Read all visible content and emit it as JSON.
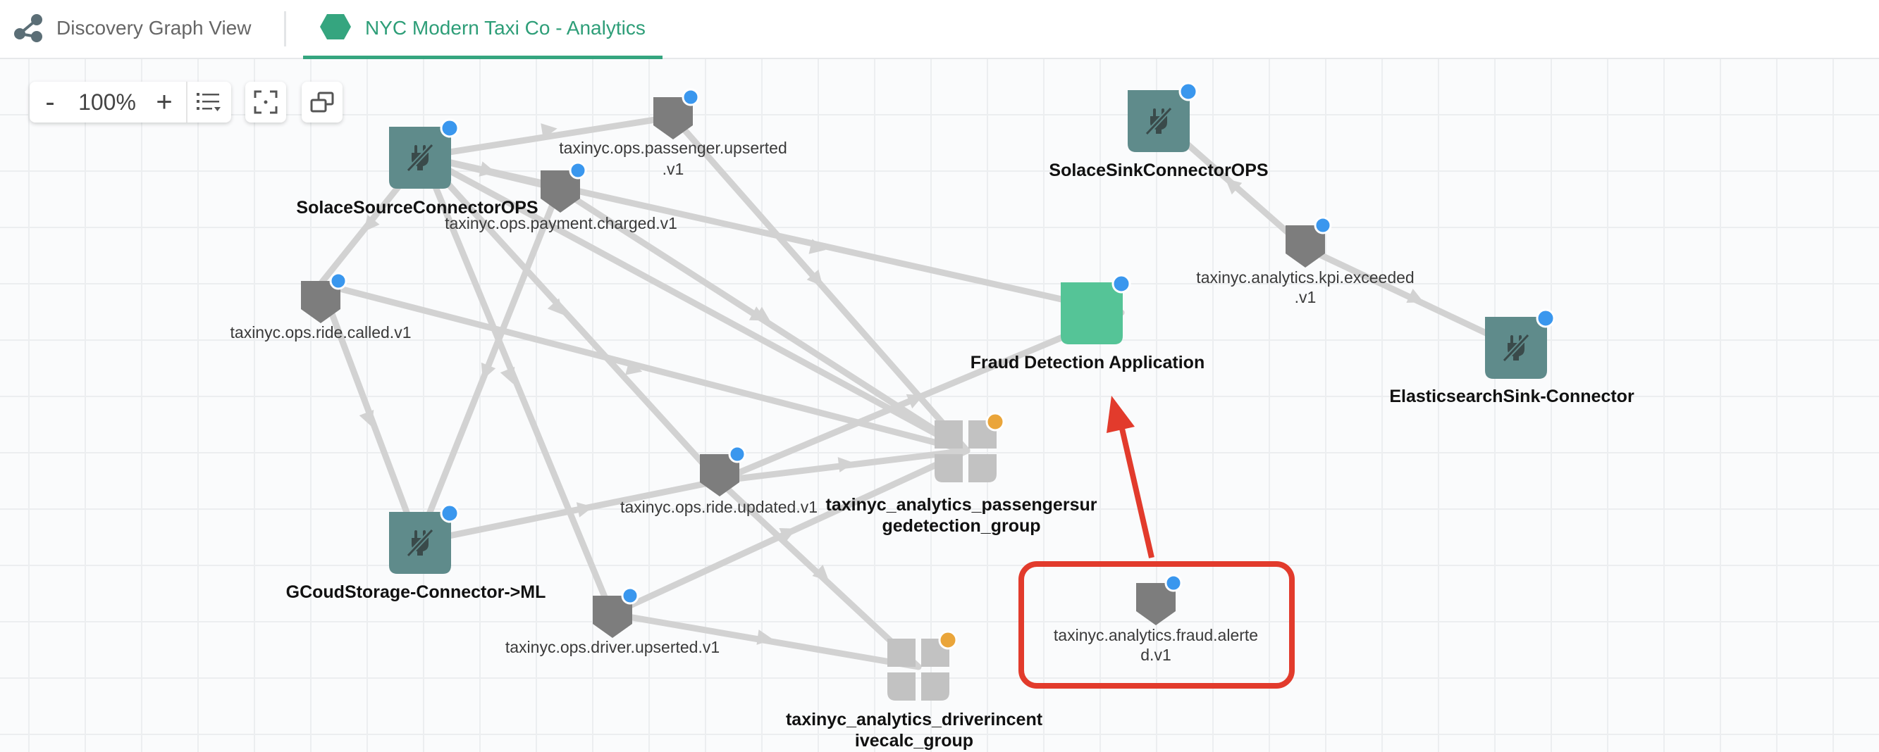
{
  "header": {
    "title": "Discovery Graph View",
    "tab_label": "NYC Modern Taxi Co - Analytics"
  },
  "toolbar": {
    "zoom_out_label": "-",
    "zoom_value": "100%",
    "zoom_in_label": "+",
    "icons": [
      "list-filter-icon",
      "fit-to-screen-icon",
      "overview-icon"
    ]
  },
  "nodes": {
    "solace_source": "SolaceSourceConnectorOPS",
    "passenger_upserted_1": "taxinyc.ops.passenger.upserted",
    "passenger_upserted_2": ".v1",
    "payment_charged": "taxinyc.ops.payment.charged.v1",
    "ride_called": "taxinyc.ops.ride.called.v1",
    "ride_updated": "taxinyc.ops.ride.updated.v1",
    "driver_upserted": "taxinyc.ops.driver.upserted.v1",
    "gcloud": "GCoudStorage-Connector->ML",
    "passenger_surge_1": "taxinyc_analytics_passengersur",
    "passenger_surge_2": "gedetection_group",
    "driver_incentive_1": "taxinyc_analytics_driverincent",
    "driver_incentive_2": "ivecalc_group",
    "fraud_app": "Fraud Detection Application",
    "fraud_alerted_1": "taxinyc.analytics.fraud.alerte",
    "fraud_alerted_2": "d.v1",
    "solace_sink": "SolaceSinkConnectorOPS",
    "kpi_exceeded_1": "taxinyc.analytics.kpi.exceeded",
    "kpi_exceeded_2": ".v1",
    "elastic_sink": "ElasticsearchSink-Connector"
  },
  "colors": {
    "accent": "#35a57f",
    "connector": "#5f8b8b",
    "application": "#55c497",
    "topic": "#7d7d7d",
    "consumer_group": "#c2c2c2",
    "edge": "#d2d2d2",
    "badge_blue": "#3a97ee",
    "badge_orange": "#eaa53a",
    "highlight": "#e23b2c"
  }
}
